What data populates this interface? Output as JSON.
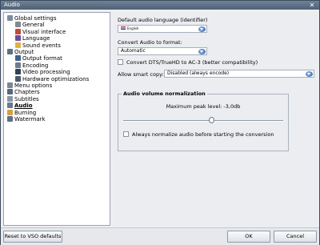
{
  "window": {
    "title": "Audio",
    "close_glyph": "✕"
  },
  "tree": {
    "items": [
      {
        "label": "Global settings",
        "indent": 0,
        "icon": "settings-icon",
        "color": "#7b8ca0"
      },
      {
        "label": "General",
        "indent": 1,
        "icon": "general-icon",
        "color": "#7e8a98"
      },
      {
        "label": "Visual interface",
        "indent": 1,
        "icon": "visual-interface-icon",
        "color": "#c24a3c"
      },
      {
        "label": "Language",
        "indent": 1,
        "icon": "language-icon",
        "color": "#6a4aa3"
      },
      {
        "label": "Sound events",
        "indent": 1,
        "icon": "sound-events-icon",
        "color": "#e0b33a"
      },
      {
        "label": "Output",
        "indent": 0,
        "icon": "output-icon",
        "color": "#5d6f86"
      },
      {
        "label": "Output format",
        "indent": 1,
        "icon": "output-format-icon",
        "color": "#3f5f8f"
      },
      {
        "label": "Encoding",
        "indent": 1,
        "icon": "encoding-icon",
        "color": "#6b7c8f"
      },
      {
        "label": "Video processing",
        "indent": 1,
        "icon": "video-processing-icon",
        "color": "#2f3f55"
      },
      {
        "label": "Hardware optimizations",
        "indent": 1,
        "icon": "hardware-icon",
        "color": "#4a5a6c"
      },
      {
        "label": "Menu options",
        "indent": 0,
        "icon": "menu-options-icon",
        "color": "#7a8696"
      },
      {
        "label": "Chapters",
        "indent": 0,
        "icon": "chapters-icon",
        "color": "#55677d"
      },
      {
        "label": "Subtitles",
        "indent": 0,
        "icon": "subtitles-icon",
        "color": "#8a94a2"
      },
      {
        "label": "Audio",
        "indent": 0,
        "icon": "audio-icon",
        "color": "#6a7a8d",
        "selected": true
      },
      {
        "label": "Burning",
        "indent": 0,
        "icon": "burning-icon",
        "color": "#d3a23b"
      },
      {
        "label": "Watermark",
        "indent": 0,
        "icon": "watermark-icon",
        "color": "#5e7088"
      }
    ]
  },
  "settings": {
    "default_language_label": "Default audio language (identifier)",
    "default_language_value": "English",
    "convert_label": "Convert Audio to format:",
    "convert_value": "Automatic",
    "dts_checkbox_label": "Convert DTS/TrueHD to AC-3 (better compatibility)",
    "dts_checked": false,
    "smart_copy_label": "Allow smart copy:",
    "smart_copy_value": "Disabled (always encode)",
    "normalization": {
      "title": "Audio volume normalization",
      "peak_label": "Maximum peak level: -3,0db",
      "slider_fraction": 0.55,
      "always_label": "Always normalize audio before starting the conversion",
      "always_checked": false
    }
  },
  "footer": {
    "reset_label": "Reset to VSO defaults",
    "ok_label": "OK",
    "cancel_label": "Cancel"
  }
}
